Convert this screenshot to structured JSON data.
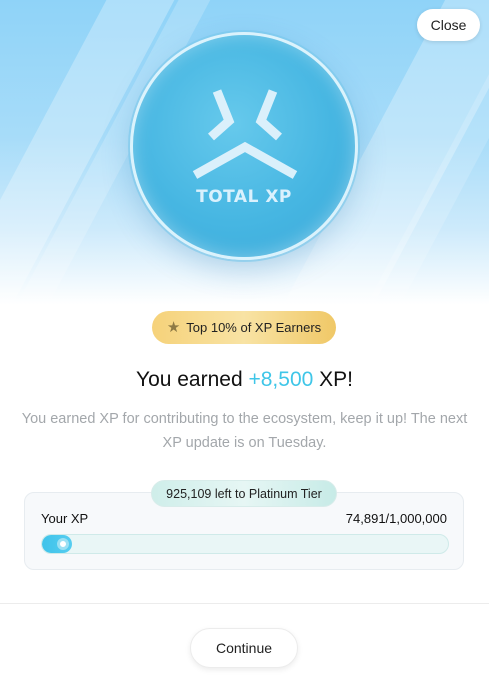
{
  "header": {
    "close_label": "Close"
  },
  "coin": {
    "label": "TOTAL XP",
    "icon": "total-xp-logo-icon"
  },
  "badge": {
    "text": "Top 10% of XP Earners",
    "icon": "star-icon"
  },
  "headline": {
    "prefix": "You earned ",
    "amount": "+8,500",
    "suffix": " XP!"
  },
  "description": "You earned XP for contributing to the ecosystem, keep it up! The next XP update is on Tuesday.",
  "xp": {
    "tier_text": "925,109 left to Platinum Tier",
    "label": "Your XP",
    "value_text": "74,891/1,000,000",
    "progress_fraction": 0.075
  },
  "footer": {
    "continue_label": "Continue"
  },
  "colors": {
    "accent": "#3fc6e8",
    "badge": "#f6d27a",
    "coin": "#46b6e2"
  }
}
